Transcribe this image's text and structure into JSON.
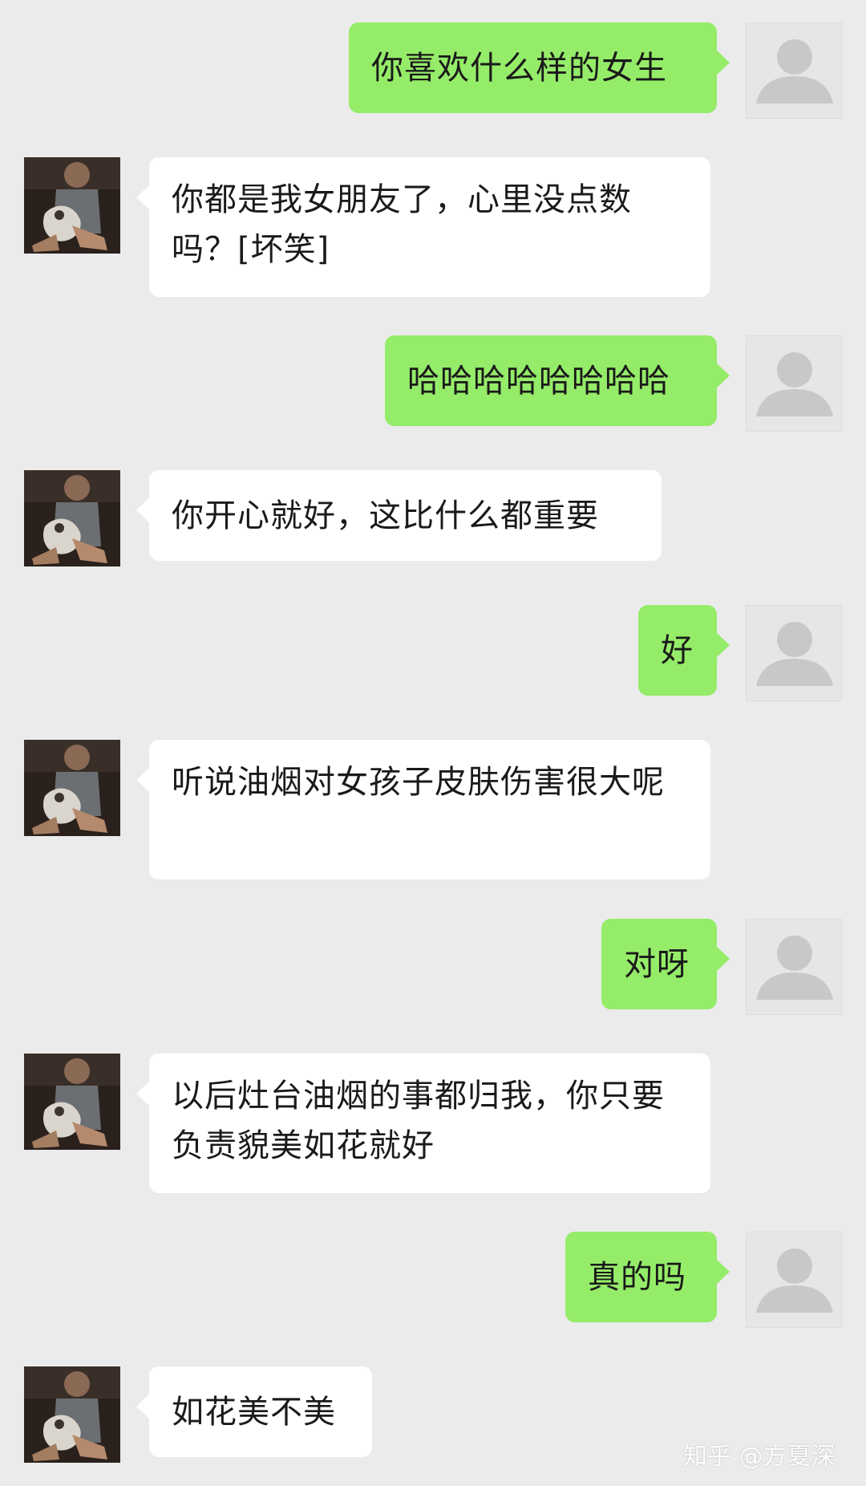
{
  "messages": [
    {
      "from": "me",
      "text": "你喜欢什么样的女生"
    },
    {
      "from": "them",
      "text": "你都是我女朋友了，心里没点数吗？[坏笑]"
    },
    {
      "from": "me",
      "text": "哈哈哈哈哈哈哈哈"
    },
    {
      "from": "them",
      "text": "你开心就好，这比什么都重要"
    },
    {
      "from": "me",
      "text": "好"
    },
    {
      "from": "them",
      "text": "听说油烟对女孩子皮肤伤害很大呢"
    },
    {
      "from": "me",
      "text": "对呀"
    },
    {
      "from": "them",
      "text": "以后灶台油烟的事都归我，你只要负责貌美如花就好"
    },
    {
      "from": "me",
      "text": "真的吗"
    },
    {
      "from": "them",
      "text": "如花美不美"
    }
  ],
  "avatars": {
    "me": "default-person-icon",
    "them": "photo-avatar"
  },
  "colors": {
    "background": "#ebebeb",
    "my_bubble": "#95ec69",
    "their_bubble": "#ffffff"
  },
  "watermark": "知乎 @方夏深"
}
